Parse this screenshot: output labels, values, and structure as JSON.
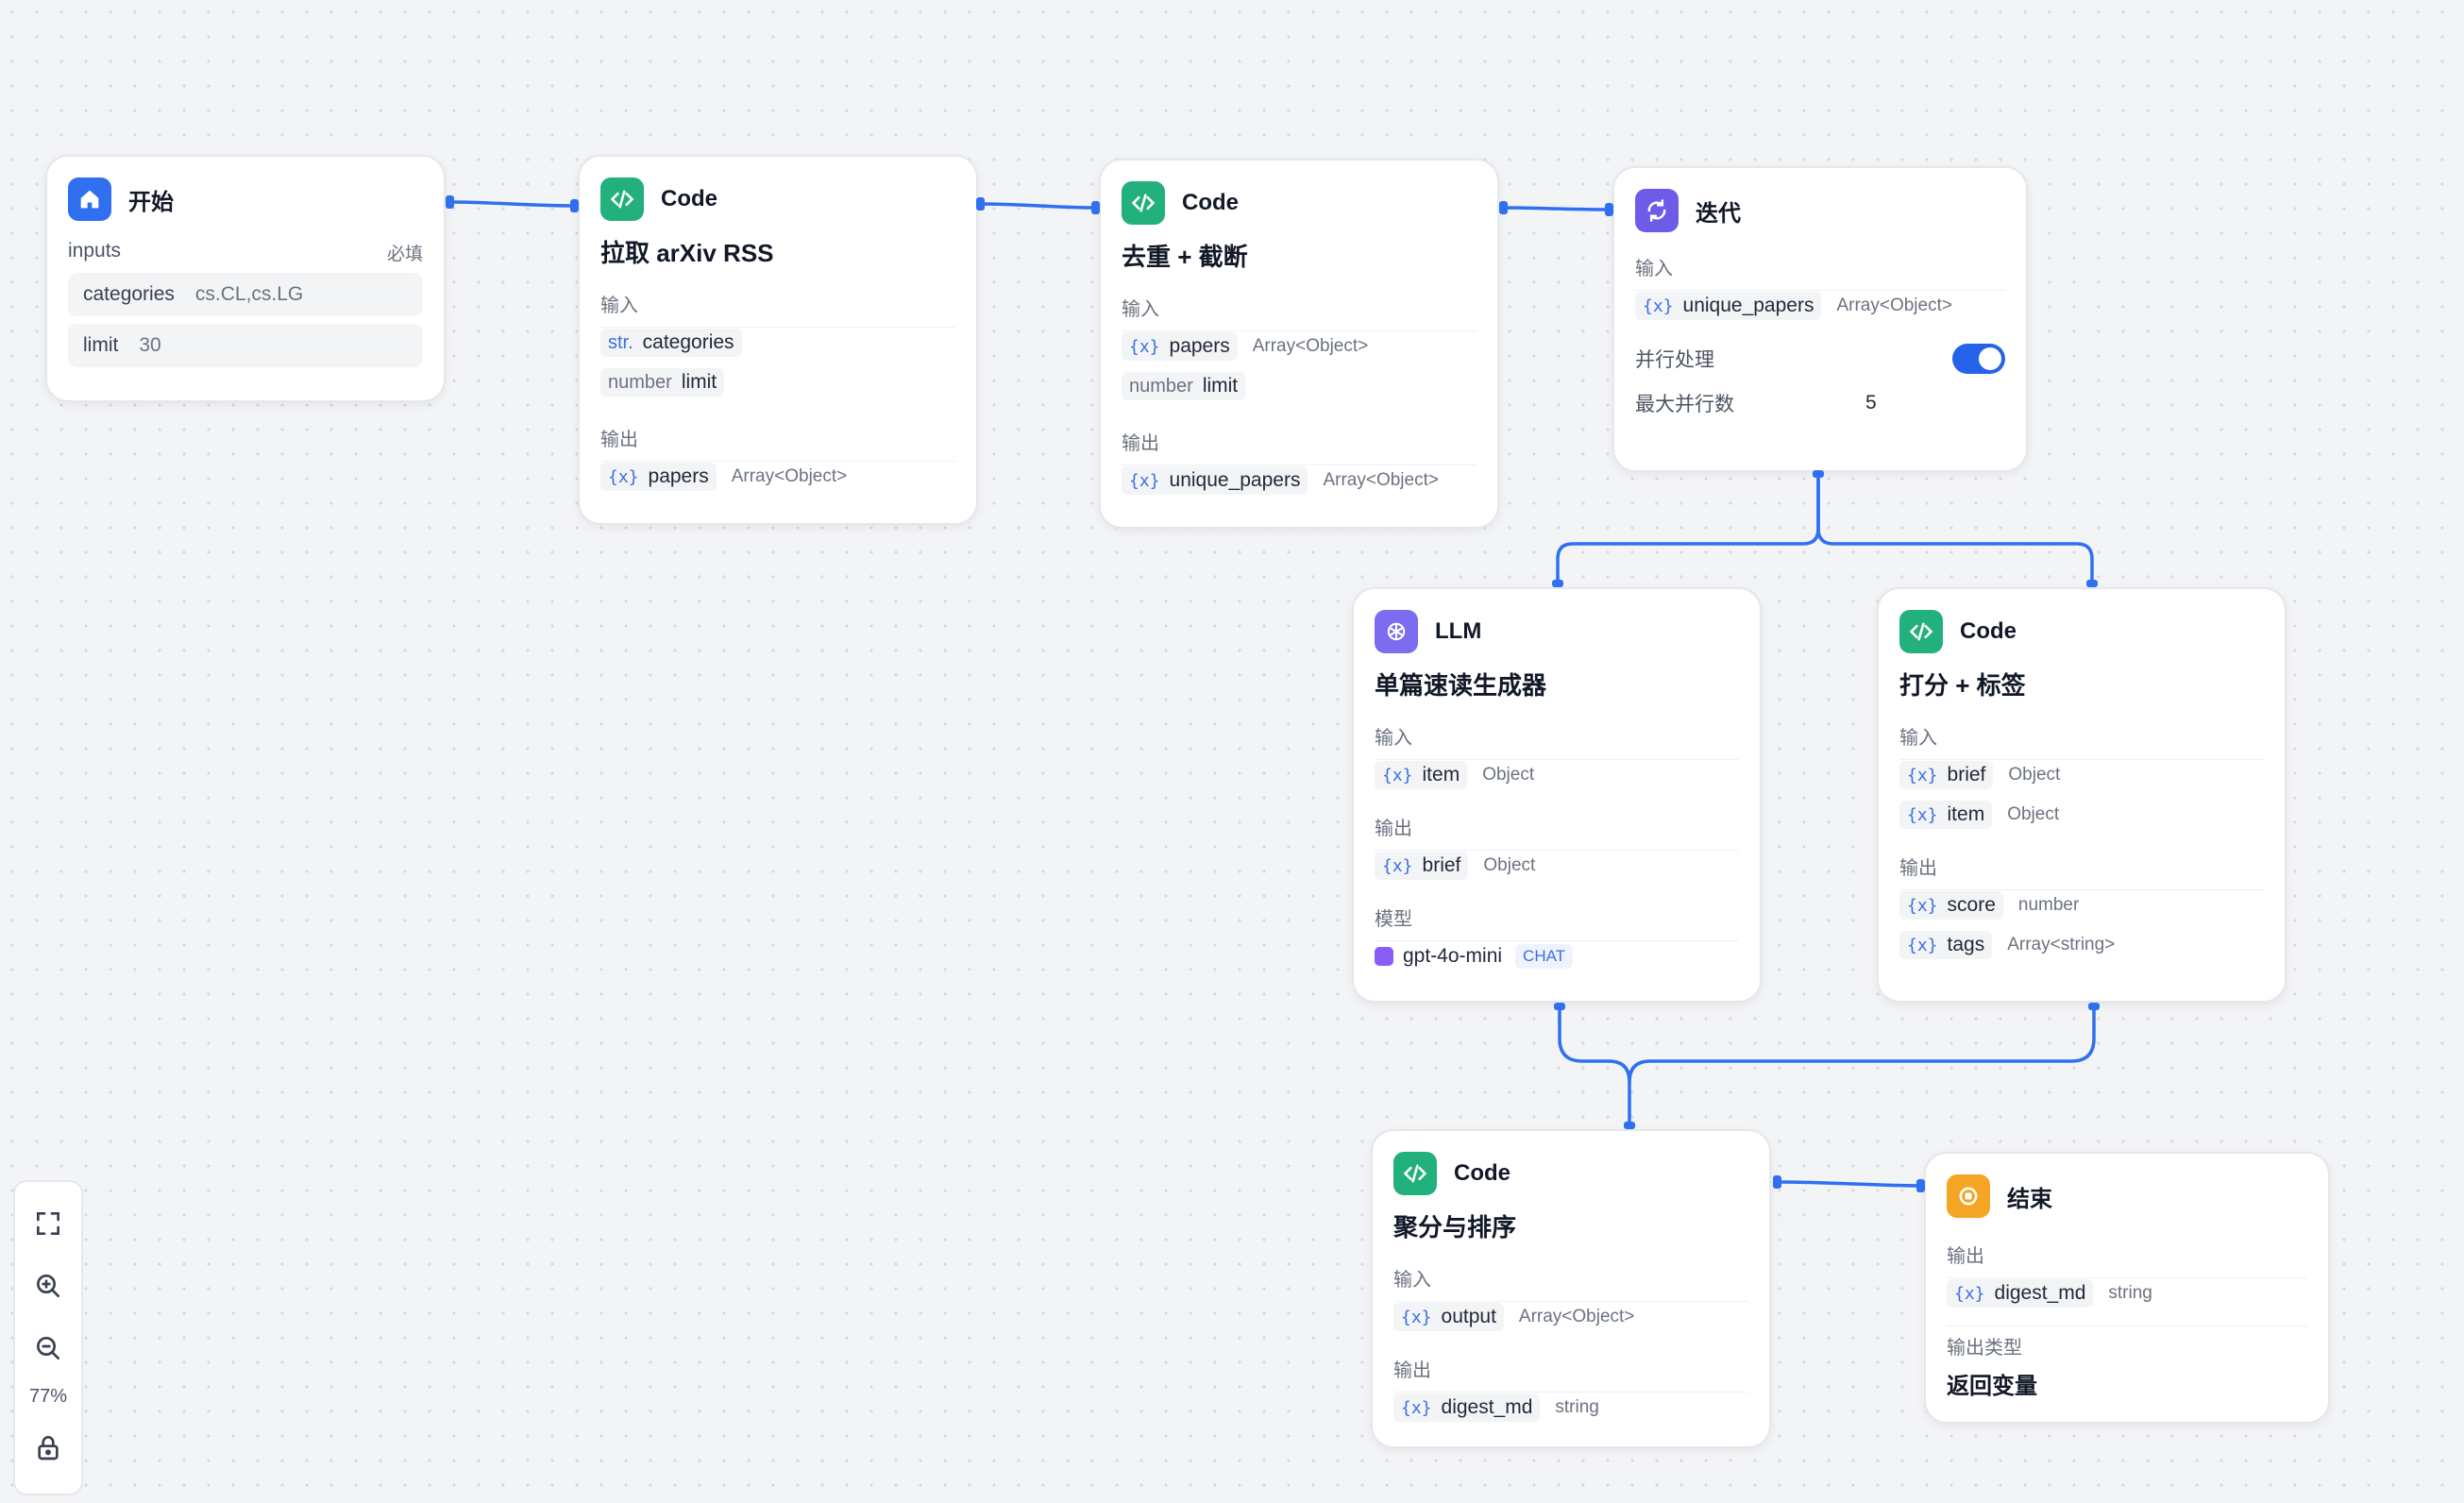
{
  "colors": {
    "accent": "#2f6ff0",
    "code": "#22b07d",
    "start": "#2f6ff0",
    "iteration": "#6d5ce8",
    "llm": "#7c6cf0",
    "end": "#f5a524"
  },
  "start": {
    "type": "开始",
    "inputs_label": "inputs",
    "required_label": "必填",
    "inputs": [
      {
        "name": "categories",
        "value": "cs.CL,cs.LG"
      },
      {
        "name": "limit",
        "value": "30"
      }
    ]
  },
  "fetch": {
    "type": "Code",
    "title": "拉取 arXiv RSS",
    "in_label": "输入",
    "out_label": "输出",
    "inputs": [
      {
        "prefix": "str.",
        "name": "categories"
      },
      {
        "prefix": "number",
        "name": "limit"
      }
    ],
    "outputs": [
      {
        "name": "papers",
        "type": "Array<Object>"
      }
    ]
  },
  "dedup": {
    "type": "Code",
    "title": "去重 + 截断",
    "in_label": "输入",
    "out_label": "输出",
    "inputs": [
      {
        "name": "papers",
        "type": "Array<Object>"
      },
      {
        "prefix": "number",
        "name": "limit"
      }
    ],
    "outputs": [
      {
        "name": "unique_papers",
        "type": "Array<Object>"
      }
    ]
  },
  "iter": {
    "type": "迭代",
    "in_label": "输入",
    "input": {
      "name": "unique_papers",
      "type": "Array<Object>"
    },
    "parallel_label": "并行处理",
    "parallel_on": true,
    "max_label": "最大并行数",
    "max_value": "5"
  },
  "llm": {
    "type": "LLM",
    "title": "单篇速读生成器",
    "in_label": "输入",
    "out_label": "输出",
    "model_label": "模型",
    "input": {
      "name": "item",
      "type": "Object"
    },
    "output": {
      "name": "brief",
      "type": "Object"
    },
    "model": "gpt-4o-mini",
    "model_tag": "CHAT"
  },
  "score": {
    "type": "Code",
    "title": "打分 + 标签",
    "in_label": "输入",
    "out_label": "输出",
    "inputs": [
      {
        "name": "brief",
        "type": "Object"
      },
      {
        "name": "item",
        "type": "Object"
      }
    ],
    "outputs": [
      {
        "name": "score",
        "type": "number"
      },
      {
        "name": "tags",
        "type": "Array<string>"
      }
    ]
  },
  "agg": {
    "type": "Code",
    "title": "聚分与排序",
    "in_label": "输入",
    "out_label": "输出",
    "input": {
      "name": "output",
      "type": "Array<Object>"
    },
    "output": {
      "name": "digest_md",
      "type": "string"
    }
  },
  "end": {
    "type": "结束",
    "out_label": "输出",
    "output": {
      "name": "digest_md",
      "type": "string"
    },
    "otype_label": "输出类型",
    "otype_value": "返回变量"
  },
  "toolbar": {
    "zoom": "77%"
  },
  "var_glyph": "{x}"
}
